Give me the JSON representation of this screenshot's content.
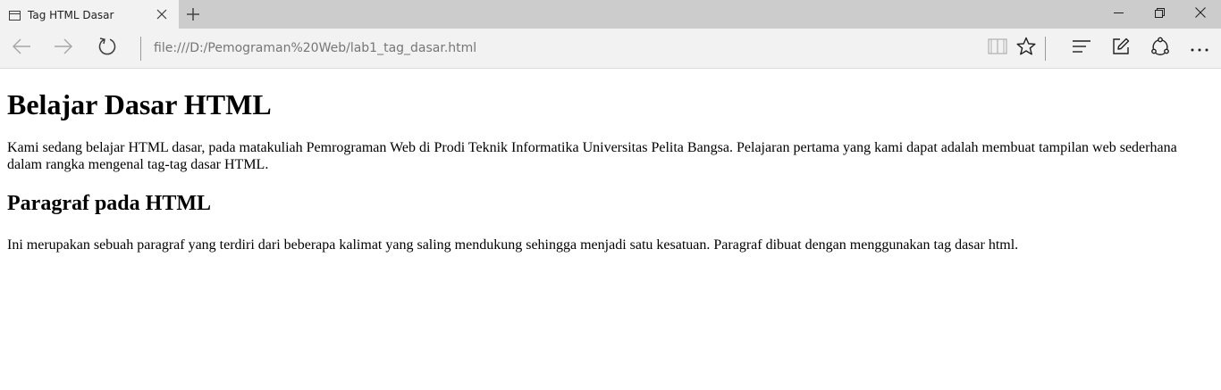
{
  "browser": {
    "tab": {
      "title": "Tag HTML Dasar",
      "icon": "page-icon"
    },
    "address_bar": {
      "value": "file:///D:/Pemograman%20Web/lab1_tag_dasar.html"
    },
    "colors": {
      "titlebar": "#cccccc",
      "toolbar": "#f2f2f2",
      "icon": "#3c3c3c",
      "address_text": "#767676"
    },
    "toolbar_icons": [
      "back-arrow-icon",
      "forward-arrow-icon",
      "refresh-icon",
      "reading-view-icon",
      "favorite-star-icon",
      "hub-icon",
      "web-note-icon",
      "share-icon",
      "more-icon"
    ]
  },
  "page": {
    "heading1": "Belajar Dasar HTML",
    "paragraph1": "Kami sedang belajar HTML dasar, pada matakuliah Pemrograman Web di Prodi Teknik Informatika Universitas Pelita Bangsa. Pelajaran pertama yang kami dapat adalah membuat tampilan web sederhana dalam rangka mengenal tag-tag dasar HTML.",
    "heading2": "Paragraf pada HTML",
    "paragraph2": "Ini merupakan sebuah paragraf yang terdiri dari beberapa kalimat yang saling mendukung sehingga menjadi satu kesatuan. Paragraf dibuat dengan menggunakan tag dasar html."
  }
}
